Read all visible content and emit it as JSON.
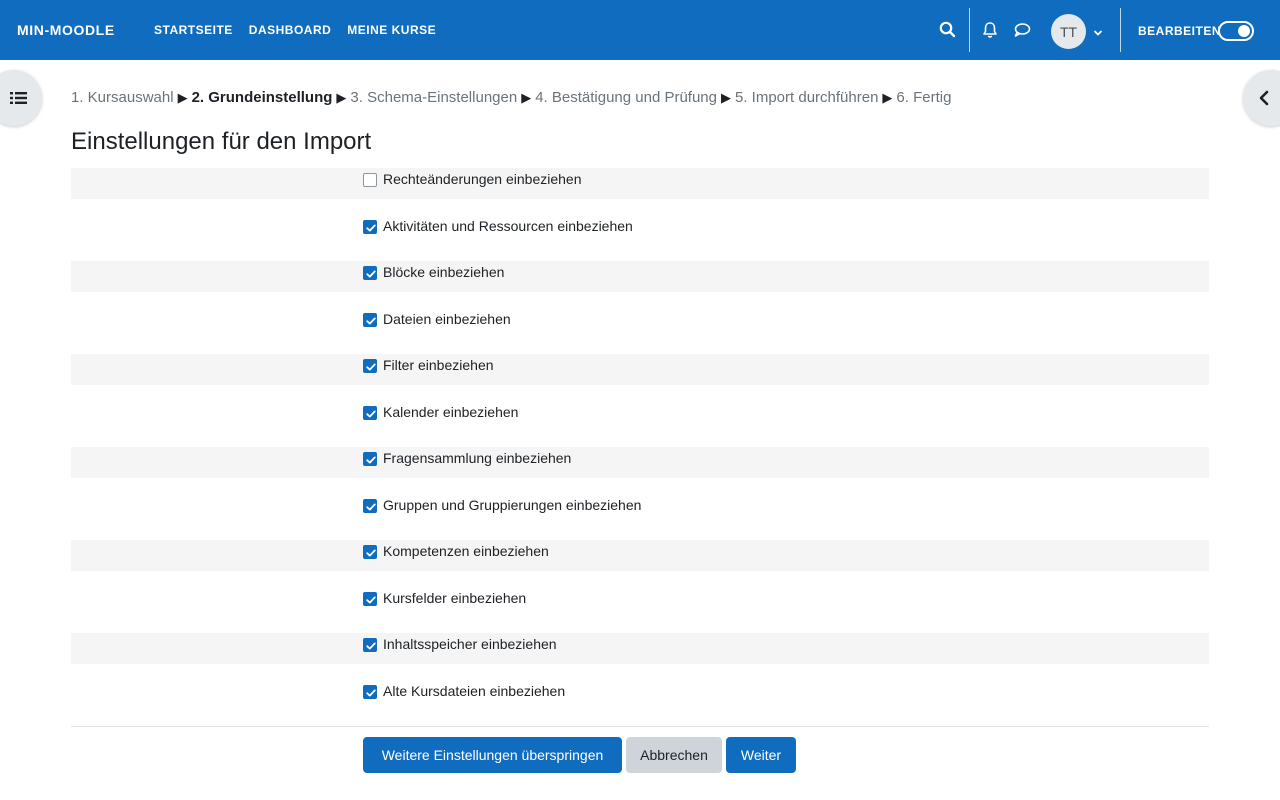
{
  "navbar": {
    "brand": "MIN-MOODLE",
    "links": [
      "STARTSEITE",
      "DASHBOARD",
      "MEINE KURSE"
    ],
    "avatar_initials": "TT",
    "edit_label": "BEARBEITEN"
  },
  "steps": {
    "items": [
      {
        "label": "1. Kursauswahl",
        "current": false
      },
      {
        "label": "2. Grundeinstellung",
        "current": true
      },
      {
        "label": "3. Schema-Einstellungen",
        "current": false
      },
      {
        "label": "4. Bestätigung und Prüfung",
        "current": false
      },
      {
        "label": "5. Import durchführen",
        "current": false
      },
      {
        "label": "6. Fertig",
        "current": false
      }
    ],
    "separator": "▶"
  },
  "page_title": "Einstellungen für den Import",
  "settings": [
    {
      "label": "Rechteänderungen einbeziehen",
      "checked": false
    },
    {
      "label": "Aktivitäten und Ressourcen einbeziehen",
      "checked": true
    },
    {
      "label": "Blöcke einbeziehen",
      "checked": true
    },
    {
      "label": "Dateien einbeziehen",
      "checked": true
    },
    {
      "label": "Filter einbeziehen",
      "checked": true
    },
    {
      "label": "Kalender einbeziehen",
      "checked": true
    },
    {
      "label": "Fragensammlung einbeziehen",
      "checked": true
    },
    {
      "label": "Gruppen und Gruppierungen einbeziehen",
      "checked": true
    },
    {
      "label": "Kompetenzen einbeziehen",
      "checked": true
    },
    {
      "label": "Kursfelder einbeziehen",
      "checked": true
    },
    {
      "label": "Inhaltsspeicher einbeziehen",
      "checked": true
    },
    {
      "label": "Alte Kursdateien einbeziehen",
      "checked": true
    }
  ],
  "buttons": {
    "skip": "Weitere Einstellungen überspringen",
    "cancel": "Abbrechen",
    "next": "Weiter"
  },
  "colors": {
    "primary": "#0f6cbf",
    "secondary": "#ced4da"
  }
}
